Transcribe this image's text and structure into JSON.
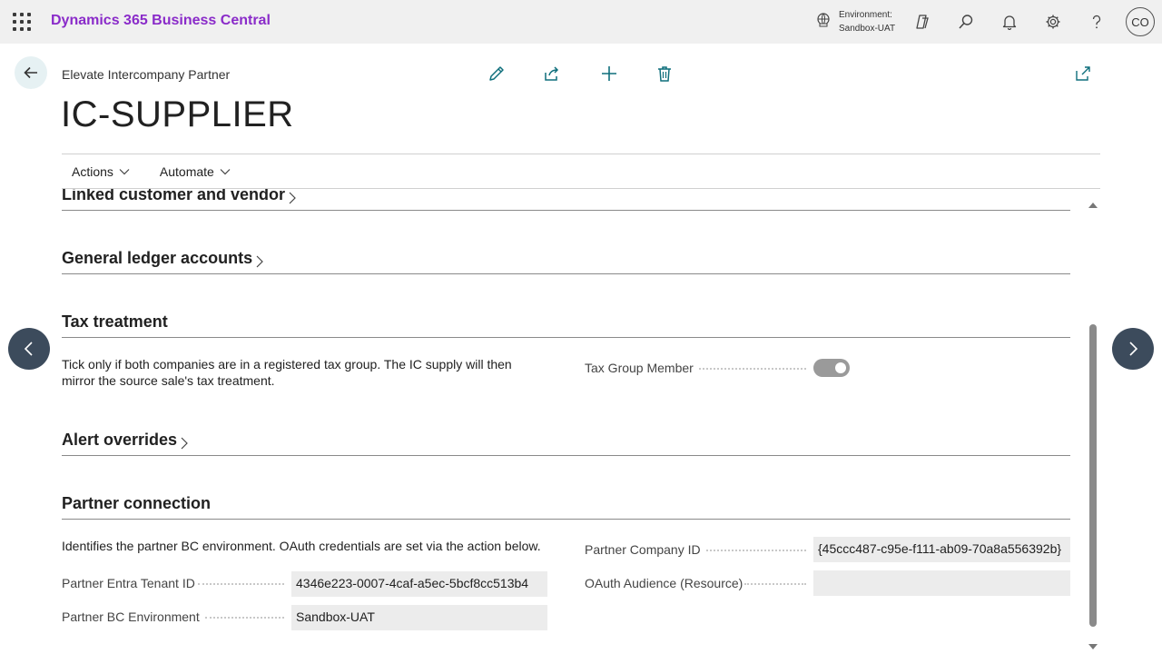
{
  "topbar": {
    "app_title": "Dynamics 365 Business Central",
    "environment_label": "Environment:",
    "environment_value": "Sandbox-UAT",
    "avatar_initials": "CO"
  },
  "header": {
    "breadcrumb": "Elevate Intercompany Partner",
    "title": "IC-SUPPLIER"
  },
  "menu": {
    "actions": "Actions",
    "automate": "Automate"
  },
  "sections": {
    "linked": "Linked customer and vendor",
    "gl_accounts": "General ledger accounts",
    "tax": "Tax treatment",
    "alerts": "Alert overrides",
    "partner": "Partner connection"
  },
  "tax": {
    "description": "Tick only if both companies are in a registered tax group. The IC supply will then mirror the source sale's tax treatment.",
    "field_label": "Tax Group Member",
    "field_value": true
  },
  "partner": {
    "description": "Identifies the partner BC environment. OAuth credentials are set via the action below.",
    "tenant_label": "Partner Entra Tenant ID",
    "tenant_value": "4346e223-0007-4caf-a5ec-5bcf8cc513b4",
    "env_label": "Partner BC Environment",
    "env_value": "Sandbox-UAT",
    "company_label": "Partner Company ID",
    "company_value": "{45ccc487-c95e-f111-ab09-70a8a556392b}",
    "audience_label": "OAuth Audience (Resource)",
    "audience_value": ""
  },
  "colors": {
    "brand": "#8a2bc9",
    "accent": "#0f6f7c",
    "nav_button": "#3c4b5c"
  }
}
